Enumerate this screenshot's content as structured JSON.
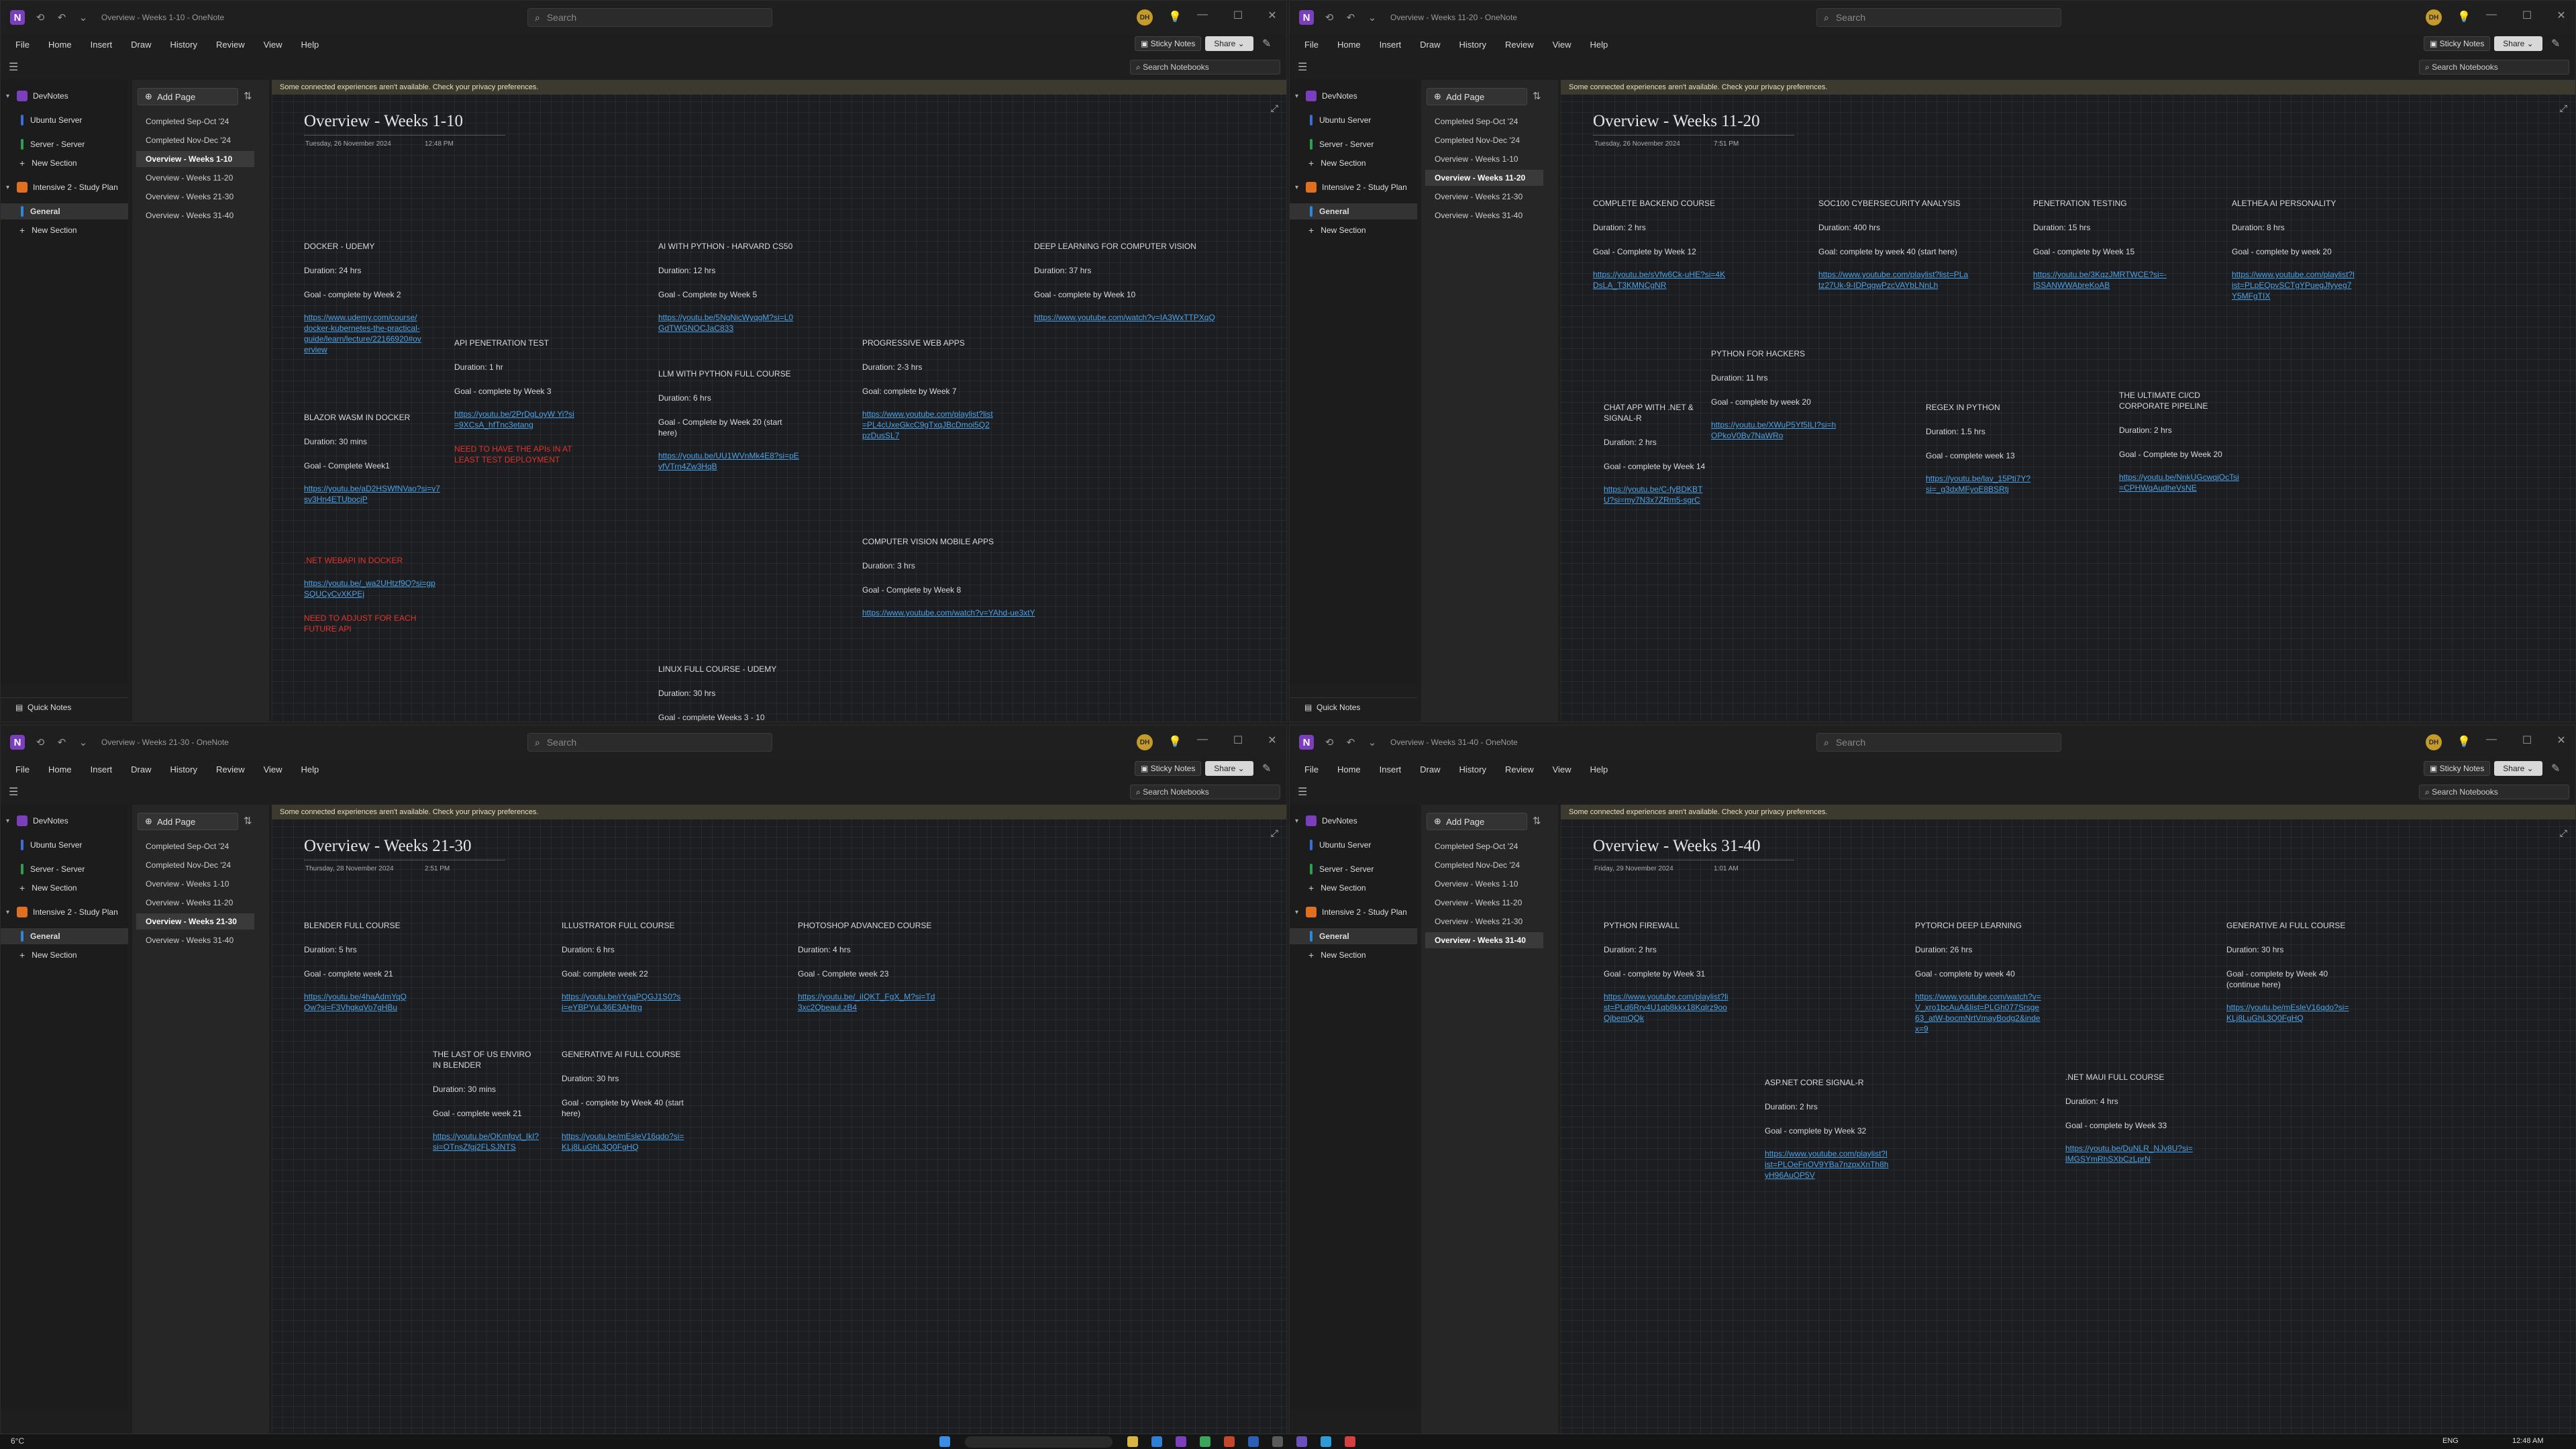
{
  "app": {
    "search_placeholder": "Search",
    "avatar_initials": "DH",
    "menu": [
      "File",
      "Home",
      "Insert",
      "Draw",
      "History",
      "Review",
      "View",
      "Help"
    ],
    "sticky_notes": "Sticky Notes",
    "share": "Share",
    "search_notebooks": "Search Notebooks",
    "add_page": "Add Page",
    "quick_notes": "Quick Notes",
    "privacy_notice": "Some connected experiences aren't available. Check your privacy preferences.",
    "notebooks": {
      "devnotes": "DevNotes",
      "ubuntu_server": "Ubuntu Server",
      "server_server": "Server - Server",
      "new_section": "New Section",
      "intensive": "Intensive 2 - Study Plan",
      "general": "General"
    },
    "colors": {
      "accent": "#7b3fbd",
      "link": "#4aa3e8",
      "warning": "#e5332a",
      "ubuntu": "#3b6fd4",
      "server": "#2e9e4f",
      "intensive": "#e07020",
      "general": "#2f86d6"
    }
  },
  "pages": {
    "completed_sep_oct": "Completed Sep-Oct '24",
    "completed_nov_dec": "Completed Nov-Dec '24",
    "weeks_1_10": "Overview - Weeks 1-10",
    "weeks_11_20": "Overview - Weeks 11-20",
    "weeks_21_30": "Overview - Weeks 21-30",
    "weeks_31_40": "Overview - Weeks 31-40"
  },
  "windows": [
    {
      "title_bar": "Overview - Weeks 1-10  -  OneNote",
      "page_title": "Overview - Weeks 1-10",
      "date": "Tuesday, 26 November 2024",
      "time": "12:48 PM",
      "cards": [
        {
          "title": "DOCKER - UDEMY",
          "duration": "Duration: 24 hrs",
          "goal": "Goal - complete by Week 2",
          "link": "https://www.udemy.com/course/docker-kubernetes-the-practical-guide/learn/lecture/22166920#overview"
        },
        {
          "title": "BLAZOR WASM IN DOCKER",
          "duration": "Duration: 30 mins",
          "goal": "Goal - Complete Week1",
          "link": "https://youtu.be/aD2HSWfNVao?si=v7sv3Hn4ETUbocjP"
        },
        {
          "title": ".NET WEBAPI IN DOCKER",
          "link": "https://youtu.be/_wa2UHtzf9Q?si=gpSQUCyCvXKPEj",
          "note": "NEED TO ADJUST FOR EACH FUTURE API"
        },
        {
          "title": "API PENETRATION TEST",
          "duration": "Duration: 1 hr",
          "goal": "Goal - complete by Week 3",
          "link": "https://youtu.be/2PrDgLoyW Yi?si=9XCsA_hfTnc3etang",
          "note": "NEED TO HAVE THE APIs IN AT LEAST TEST DEPLOYMENT"
        },
        {
          "title": "AI WITH PYTHON - HARVARD CS50",
          "duration": "Duration: 12 hrs",
          "goal": "Goal - Complete by Week 5",
          "link": "https://youtu.be/5NgNicWyqgM?si=L0GdTWGNOCJaC833"
        },
        {
          "title": "LLM WITH PYTHON FULL COURSE",
          "duration": "Duration: 6 hrs",
          "goal": "Goal - Complete by Week 20 (start here)",
          "link": "https://youtu.be/UU1WVnMk4E8?si=pEvfVTrn4Zw3HqB"
        },
        {
          "title": "LINUX FULL COURSE - UDEMY",
          "duration": "Duration: 30 hrs",
          "goal": "Goal - complete Weeks 3 - 10"
        },
        {
          "title": "PROGRESSIVE WEB APPS",
          "duration": "Duration: 2-3 hrs",
          "goal": "Goal: complete by Week 7",
          "link": "https://www.youtube.com/playlist?list=PL4cUxeGkcC9gTxqJBcDmoi5Q2pzDusSL7"
        },
        {
          "title": "COMPUTER VISION MOBILE APPS",
          "duration": "Duration: 3 hrs",
          "goal": "Goal - Complete by Week 8",
          "link": "https://www.youtube.com/watch?v=YAhd-ue3xtY"
        },
        {
          "title": "DEEP LEARNING FOR COMPUTER VISION",
          "duration": "Duration: 37 hrs",
          "goal": "Goal - complete by Week 10",
          "link": "https://www.youtube.com/watch?v=IA3WxTTPXqQ"
        }
      ]
    },
    {
      "title_bar": "Overview - Weeks 11-20  -  OneNote",
      "page_title": "Overview - Weeks 11-20",
      "date": "Tuesday, 26 November 2024",
      "time": "7:51 PM",
      "cards": [
        {
          "title": "COMPLETE BACKEND COURSE",
          "duration": "Duration: 2 hrs",
          "goal": "Goal - Complete by Week 12",
          "link": "https://youtu.be/sVfw6Ck-uHE?si=4KDsLA_T3KMNCgNR"
        },
        {
          "title": "CHAT APP WITH .NET & SIGNAL-R",
          "duration": "Duration: 2 hrs",
          "goal": "Goal - complete by Week 14",
          "link": "https://youtu.be/C-fyBDKBTU?si=my7N3x7ZRm5-sgrC"
        },
        {
          "title": "SOC100 CYBERSECURITY ANALYSIS",
          "duration": "Duration: 400 hrs",
          "goal": "Goal: complete by week 40 (start here)",
          "link": "https://www.youtube.com/playlist?list=PLatz27Uk-9-IDPqgwPzcVAYbLNnLh"
        },
        {
          "title": "PYTHON FOR HACKERS",
          "duration": "Duration: 11 hrs",
          "goal": "Goal - complete by week 20",
          "link": "https://youtu.be/XWuP5Yf5ILI?si=hOPkoV0Bv7NaWRo"
        },
        {
          "title": "PENETRATION TESTING",
          "duration": "Duration: 15 hrs",
          "goal": "Goal - complete by Week 15",
          "link": "https://youtu.be/3KqzJMRTWCE?si=-ISSANWWAbreKoAB"
        },
        {
          "title": "REGEX IN PYTHON",
          "duration": "Duration: 1.5 hrs",
          "goal": "Goal - complete week 13",
          "link": "https://youtu.be/lav_15Pti7Y?si=_g3dxMFyoE8BSRtj"
        },
        {
          "title": "ALETHEA AI PERSONALITY",
          "duration": "Duration: 8 hrs",
          "goal": "Goal - complete by week 20",
          "link": "https://www.youtube.com/playlist?list=PLpEQpvSCTgYPuegJfyyeg7Y5MFgTIX"
        },
        {
          "title": "THE ULTIMATE CI/CD CORPORATE PIPELINE",
          "duration": "Duration: 2 hrs",
          "goal": "Goal - Complete by Week 20",
          "link": "https://youtu.be/NnkUGcwqjOcTsi=CPHWqAudheVsNE"
        }
      ]
    },
    {
      "title_bar": "Overview - Weeks 21-30  -  OneNote",
      "page_title": "Overview - Weeks 21-30",
      "date": "Thursday, 28 November 2024",
      "time": "2:51 PM",
      "cards": [
        {
          "title": "BLENDER FULL COURSE",
          "duration": "Duration: 5 hrs",
          "goal": "Goal - complete week 21",
          "link": "https://youtu.be/4haAdmYqQOw?si=F3VhgkqVo7gHBu"
        },
        {
          "title": "THE LAST OF US ENVIRO IN BLENDER",
          "duration": "Duration: 30 mins",
          "goal": "Goal - complete week 21",
          "link": "https://youtu.be/OKmfgvt_IkI?si=OTnsZfgj2FLSJNTS"
        },
        {
          "title": "ILLUSTRATOR FULL COURSE",
          "duration": "Duration: 6 hrs",
          "goal": "Goal: complete week 22",
          "link": "https://youtu.be/rYgaPQGJ1S0?si=eYBPYuL36E3AHtrg"
        },
        {
          "title": "GENERATIVE AI FULL COURSE",
          "duration": "Duration: 30 hrs",
          "goal": "Goal - complete by Week 40 (start here)",
          "link": "https://youtu.be/mEsleV16qdo?si=KLj8LuGhL3Q0FgHQ"
        },
        {
          "title": "PHOTOSHOP ADVANCED COURSE",
          "duration": "Duration: 4 hrs",
          "goal": "Goal - Complete week 23",
          "link": "https://youtu.be/_iIQKT_FgX_M?si=Td3xc2Qbeaul.zB4"
        }
      ]
    },
    {
      "title_bar": "Overview - Weeks 31-40  -  OneNote",
      "page_title": "Overview - Weeks 31-40",
      "date": "Friday, 29 November 2024",
      "time": "1:01 AM",
      "cards": [
        {
          "title": "PYTHON FIREWALL",
          "duration": "Duration: 2 hrs",
          "goal": "Goal - complete by Week 31",
          "link": "https://www.youtube.com/playlist?list=PLd6Rrv4U1qb8kkx18Kqlrz9ooQjbemQQk"
        },
        {
          "title": "ASP.NET CORE SIGNAL-R",
          "duration": "Duration: 2 hrs",
          "goal": "Goal - complete by Week 32",
          "link": "https://www.youtube.com/playlist?list=PLOeFnOV9YBa7nzpxXnTh8hyH96AuOP5V"
        },
        {
          "title": "PYTORCH DEEP LEARNING",
          "duration": "Duration: 26 hrs",
          "goal": "Goal - complete by week 40",
          "link": "https://www.youtube.com/watch?v=V_xro1bcAuA&list=PLGh077Srsge63_atW-bocmNrtVmayBodg2&index=9"
        },
        {
          "title": ".NET MAUI FULL COURSE",
          "duration": "Duration: 4 hrs",
          "goal": "Goal - complete by Week 33",
          "link": "https://youtu.be/DuNLR_NJv8U?si=lMGSYmRhSXbCzLprN"
        },
        {
          "title": "GENERATIVE AI FULL COURSE",
          "duration": "Duration: 30 hrs",
          "goal": "Goal - complete by Week 40 (continue here)",
          "link": "https://youtu.be/mEsleV16qdo?si=KLj8LuGhL3Q0FgHQ"
        }
      ]
    }
  ],
  "taskbar": {
    "weather": "6°C",
    "language": "ENG",
    "time": "12:48 AM"
  }
}
